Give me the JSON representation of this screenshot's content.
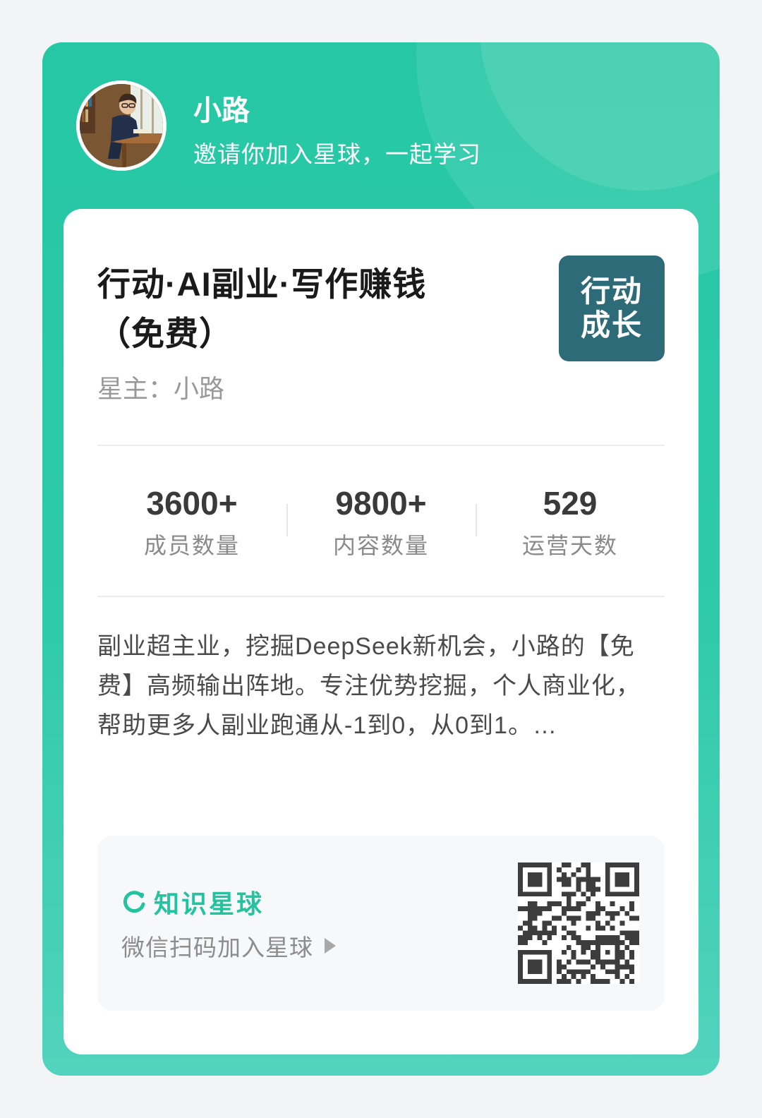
{
  "header": {
    "name": "小路",
    "invite": "邀请你加入星球，一起学习",
    "avatar_icon": "avatar-photo-student-reading"
  },
  "group": {
    "title": "行动·AI副业·写作赚钱（免费）",
    "logo_line1": "行动",
    "logo_line2": "成长",
    "owner_label": "星主：",
    "owner_name": "小路"
  },
  "stats": [
    {
      "value": "3600+",
      "label": "成员数量"
    },
    {
      "value": "9800+",
      "label": "内容数量"
    },
    {
      "value": "529",
      "label": "运营天数"
    }
  ],
  "description": "副业超主业，挖掘DeepSeek新机会，小路的【免费】高频输出阵地。专注优势挖掘，个人商业化，帮助更多人副业跑通从-1到0，从0到1。…",
  "footer": {
    "brand": "知识星球",
    "scan_text": "微信扫码加入星球",
    "brand_icon": "zsxq-logo-icon",
    "arrow_icon": "triangle-right-icon",
    "qr_icon": "qr-code"
  },
  "colors": {
    "primary": "#25c7a5",
    "badge": "#2d6b79",
    "brand_green": "#22c39e"
  }
}
